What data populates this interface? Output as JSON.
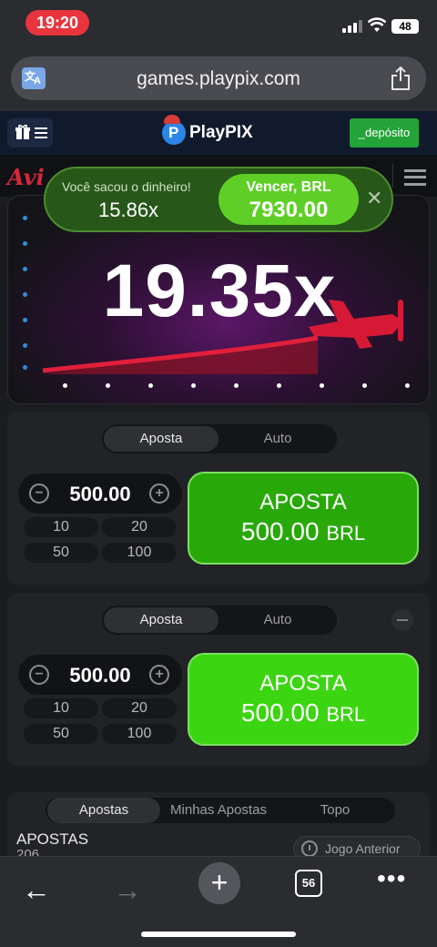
{
  "status_bar": {
    "time": "19:20",
    "battery": "48"
  },
  "browser": {
    "url": "games.playpix.com",
    "tabs_count": "56"
  },
  "site": {
    "logo_text": "PlayPIX",
    "deposit_label": "_depósito"
  },
  "game": {
    "logo_text": "Avi",
    "multiplier": "19.35x",
    "toast": {
      "label": "Você sacou o dinheiro!",
      "multiplier": "15.86x",
      "win_label": "Vencer, BRL",
      "win_amount": "7930.00"
    }
  },
  "panels": [
    {
      "tabs": [
        "Aposta",
        "Auto"
      ],
      "stake": "500.00",
      "quick": [
        "10",
        "20",
        "50",
        "100"
      ],
      "bet_title": "APOSTA",
      "bet_amount": "500.00",
      "currency": "BRL"
    },
    {
      "tabs": [
        "Aposta",
        "Auto"
      ],
      "stake": "500.00",
      "quick": [
        "10",
        "20",
        "50",
        "100"
      ],
      "bet_title": "APOSTA",
      "bet_amount": "500.00",
      "currency": "BRL"
    }
  ],
  "bets": {
    "tabs": [
      "Apostas",
      "Minhas Apostas",
      "Topo"
    ],
    "title": "APOSTAS",
    "count": "206",
    "prev_round_label": "Jogo Anterior"
  }
}
